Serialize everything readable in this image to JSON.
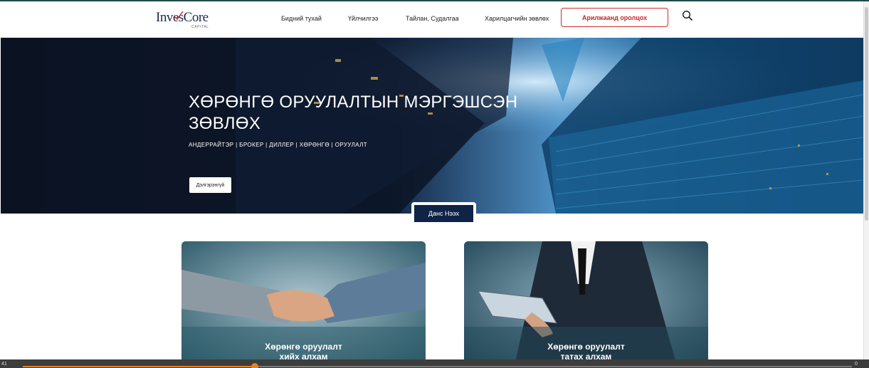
{
  "header": {
    "logo_text": "InvesCore",
    "logo_sub": "CAPITAL",
    "nav": [
      {
        "label": "Бидний тухай"
      },
      {
        "label": "Үйлчилгээ"
      },
      {
        "label": "Тайлан, Судалгаа"
      },
      {
        "label": "Харилцагчийн зөвлөх"
      }
    ],
    "cta_label": "Арилжаанд оролцох",
    "search_icon": "search-icon"
  },
  "hero": {
    "title": "ХӨРӨНГӨ ОРУУЛАЛТЫН МЭРГЭШСЭН ЗӨВЛӨХ",
    "subtitle": "АНДЕРРАЙТЭР | БРОКЕР | ДИЛЛЕР | ХӨРӨНГӨ | ОРУУЛАЛТ",
    "button_label": "Дэлгэрэнгүй"
  },
  "account_button": "Данс Нээх",
  "cards": [
    {
      "title_line1": "Хөрөнгө оруулалт",
      "title_line2": "хийх алхам"
    },
    {
      "title_line1": "Хөрөнгө оруулалт",
      "title_line2": "татах алхам"
    }
  ],
  "video_bar": {
    "elapsed": "41",
    "remaining": "0",
    "progress": 0.28
  },
  "colors": {
    "accent_red": "#c62626",
    "navy": "#0f2346",
    "progress": "#e0822a"
  }
}
